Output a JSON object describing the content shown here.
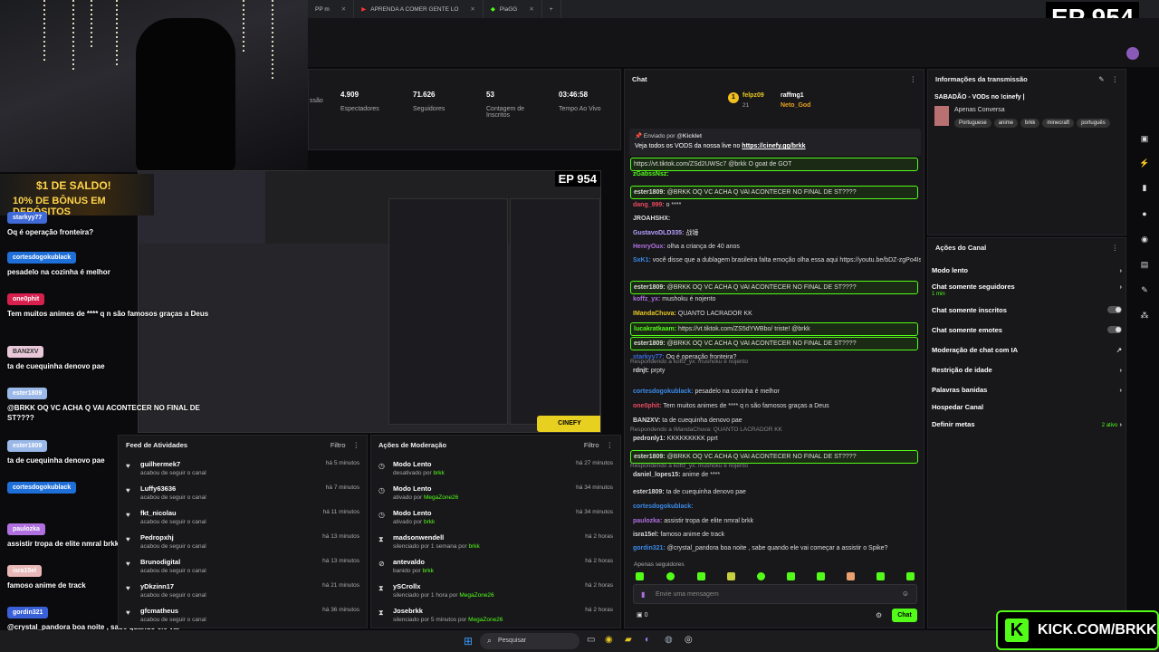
{
  "browser": {
    "tabs": [
      {
        "label": "PP m"
      },
      {
        "label": "APRENDA A COMER GENTE LO"
      },
      {
        "label": "PiaGG"
      }
    ],
    "new_tab": "+"
  },
  "episode": "EP 954",
  "promo": {
    "line1": "$1 DE SALDO!",
    "line2": "10% DE BÔNUS EM DEPÓSITOS"
  },
  "overlay_chat": [
    {
      "user": "starkyy77",
      "text": "Oq é operação fronteira?",
      "color": "#3f6ad8"
    },
    {
      "user": "cortesdogokublack",
      "text": "pesadelo na cozinha é melhor",
      "color": "#1f6fd8"
    },
    {
      "user": "one0phit",
      "text": "Tem muitos animes de **** q n são famosos graças a Deus",
      "color": "#d8204f"
    },
    {
      "user": "BAN2XV",
      "text": "ta de cuequinha denovo pae",
      "color": "#e8c8d8"
    },
    {
      "user": "ester1809",
      "text": "@BRKK OQ VC ACHA Q VAI ACONTECER NO FINAL DE ST????",
      "color": "#9ab8e8"
    },
    {
      "user": "ester1809",
      "text": "ta de cuequinha denovo pae",
      "color": "#9ab8e8"
    },
    {
      "user": "cortesdogokublack",
      "text": "",
      "color": "#1f6fd8"
    },
    {
      "user": "paulozka",
      "text": "assistir tropa de elite nmral brkk",
      "color": "#b070e0"
    },
    {
      "user": "isra15el",
      "text": "famoso anime de track",
      "color": "#e8b8b8"
    },
    {
      "user": "gordin321",
      "text": "@crystal_pandora boa noite , sabe quando ele vai começar a assistir o Spike?",
      "color": "#3a60d8"
    }
  ],
  "stats": [
    {
      "value": "",
      "label": "ssão"
    },
    {
      "value": "4.909",
      "label": "Espectadores"
    },
    {
      "value": "71.626",
      "label": "Seguidores"
    },
    {
      "value": "53",
      "label": "Contagem de Inscritos"
    },
    {
      "value": "03:46:58",
      "label": "Tempo Ao Vivo"
    }
  ],
  "feed": {
    "title": "Feed de Atividades",
    "filter": "Filtro",
    "items": [
      {
        "name": "guilhermek7",
        "desc": "acabou de seguir o canal",
        "time": "há 5 minutos"
      },
      {
        "name": "Luffy63636",
        "desc": "acabou de seguir o canal",
        "time": "há 7 minutos"
      },
      {
        "name": "fkt_nicolau",
        "desc": "acabou de seguir o canal",
        "time": "há 11 minutos"
      },
      {
        "name": "Pedropxhj",
        "desc": "acabou de seguir o canal",
        "time": "há 13 minutos"
      },
      {
        "name": "Brunodigital",
        "desc": "acabou de seguir o canal",
        "time": "há 13 minutos"
      },
      {
        "name": "yDkzinn17",
        "desc": "acabou de seguir o canal",
        "time": "há 21 minutos"
      },
      {
        "name": "gfcmatheus",
        "desc": "acabou de seguir o canal",
        "time": "há 36 minutos"
      }
    ]
  },
  "moderation": {
    "title": "Ações de Moderação",
    "filter": "Filtro",
    "items": [
      {
        "name": "Modo Lento",
        "desc": "desativado por",
        "by": "brkk",
        "time": "há 27 minutos"
      },
      {
        "name": "Modo Lento",
        "desc": "ativado por",
        "by": "MegaZone26",
        "time": "há 34 minutos"
      },
      {
        "name": "Modo Lento",
        "desc": "ativado por",
        "by": "brkk",
        "time": "há 34 minutos"
      },
      {
        "name": "madsonwendell",
        "desc": "silenciado por 1 semana por",
        "by": "brkk",
        "time": "há 2 horas"
      },
      {
        "name": "antevaldo",
        "desc": "banido por",
        "by": "brkk",
        "time": "há 2 horas"
      },
      {
        "name": "ySCrollx",
        "desc": "silenciado por 1 hora por",
        "by": "MegaZone26",
        "time": "há 2 horas"
      },
      {
        "name": "Josebrkk",
        "desc": "silenciado por 5 minutos por",
        "by": "MegaZone26",
        "time": "há 2 horas"
      }
    ]
  },
  "chat": {
    "title": "Chat",
    "top": {
      "first": "felpz09",
      "first_count": "21",
      "second": "raffmg1",
      "third": "Neto_God"
    },
    "pinned": {
      "by_label": "Enviado por",
      "by": "@Kicklet",
      "text": "Veja todos os VODS da nossa live no ",
      "link": "https://cinefy.gg/brkk"
    },
    "messages": [
      {
        "user": "",
        "text": "https://vt.tiktok.com/ZSd2UWSc7 @brkk O goat de GOT",
        "color": "#e84a5f",
        "hl": true
      },
      {
        "user": "zGabssNsz:",
        "text": "",
        "color": "#53fc18",
        "hl": false
      },
      {
        "user": "ester1809:",
        "text": "@BRKK OQ VC ACHA Q VAI ACONTECER NO FINAL DE ST????",
        "color": "#ddd",
        "hl": true
      },
      {
        "user": "dang_999:",
        "text": "o ****",
        "color": "#e84a5f",
        "hl": false
      },
      {
        "user": "JROAHSHX:",
        "text": "",
        "color": "#ddd",
        "hl": false
      },
      {
        "user": "GustavoDLD335:",
        "text": "战锤",
        "color": "#b8a0ff",
        "hl": false
      },
      {
        "user": "HenryOux:",
        "text": "olha a criança de 40 anos",
        "color": "#b070e0",
        "hl": false
      },
      {
        "user": "SxK1:",
        "text": "você disse que a dublagem brasileira falta emoção olha essa aqui https://youtu.be/bDZ-zgPo4Is?si=aAgS3mmWICvu_NW",
        "color": "#3a8ae8",
        "hl": false
      },
      {
        "user": "ester1809:",
        "text": "@BRKK OQ VC ACHA Q VAI ACONTECER NO FINAL DE ST????",
        "color": "#ddd",
        "hl": true
      },
      {
        "user": "koffz_yx:",
        "text": "mushoku é nojento",
        "color": "#b070e0",
        "hl": false
      },
      {
        "user": "IMandaChuva:",
        "text": "QUANTO LACRADOR KK",
        "color": "#e8c820",
        "hl": false
      },
      {
        "user": "lucakratkaam:",
        "text": "https://vt.tiktok.com/ZS5dYWBbo/ triste! @brkk",
        "color": "#53fc18",
        "hl": true
      },
      {
        "user": "ester1809:",
        "text": "@BRKK OQ VC ACHA Q VAI ACONTECER NO FINAL DE ST????",
        "color": "#ddd",
        "hl": true
      },
      {
        "user": "starkyy77:",
        "text": "Oq é operação fronteira?",
        "color": "#3a6ad8",
        "hl": false
      },
      {
        "user": "rdnjt:",
        "text": "prpty",
        "color": "#ddd",
        "hl": false,
        "reply": "Respondendo a koffz_yx: mushoku é nojento"
      },
      {
        "user": "cortesdogokublack:",
        "text": "pesadelo na cozinha é melhor",
        "color": "#3a8ae8",
        "hl": false
      },
      {
        "user": "one0phit:",
        "text": "Tem muitos animes de **** q n são famosos graças a Deus",
        "color": "#e84a5f",
        "hl": false
      },
      {
        "user": "BAN2XV:",
        "text": "ta de cuequinha denovo pae",
        "color": "#ddd",
        "hl": false
      },
      {
        "user": "pedronly1:",
        "text": "KKKKKKKKK pprt",
        "color": "#ddd",
        "hl": false,
        "reply": "Respondendo a IMandaChuva: QUANTO LACRADOR KK"
      },
      {
        "user": "ester1809:",
        "text": "@BRKK OQ VC ACHA Q VAI ACONTECER NO FINAL DE ST????",
        "color": "#ddd",
        "hl": true
      },
      {
        "user": "daniel_lopes15:",
        "text": "anime de ****",
        "color": "#ddd",
        "hl": false,
        "reply": "Respondendo a koffz_yx: mushoku é nojento"
      },
      {
        "user": "ester1809:",
        "text": "ta de cuequinha denovo pae",
        "color": "#ddd",
        "hl": false
      },
      {
        "user": "cortesdogokublack:",
        "text": "",
        "color": "#3a8ae8",
        "hl": false
      },
      {
        "user": "paulozka:",
        "text": "assistir tropa de elite nmral brkk",
        "color": "#b070e0",
        "hl": false
      },
      {
        "user": "isra15el:",
        "text": "famoso anime de track",
        "color": "#ddd",
        "hl": false
      },
      {
        "user": "gordin321:",
        "text": "@crystal_pandora boa noite , sabe quando ele vai começar a assistir o Spike?",
        "color": "#3a8ae8",
        "hl": false
      }
    ],
    "followers_only": "Apenas seguidores",
    "input_placeholder": "Envie uma mensagem",
    "count": "0",
    "send": "Chat"
  },
  "info": {
    "title": "Informações da transmissão",
    "stream_title": "SABADÃO - VODs no !cinefy |",
    "category": "Apenas Conversa",
    "tags": [
      "Portuguese",
      "anime",
      "brkk",
      "minecraft",
      "português"
    ]
  },
  "channel_actions": {
    "title": "Ações do Canal",
    "items": [
      {
        "label": "Modo lento",
        "sub": "",
        "control": "chevron"
      },
      {
        "label": "Chat somente seguidores",
        "sub": "1 min",
        "control": "chevron"
      },
      {
        "label": "Chat somente inscritos",
        "sub": "",
        "control": "toggle"
      },
      {
        "label": "Chat somente emotes",
        "sub": "",
        "control": "toggle"
      },
      {
        "label": "Moderação de chat com IA",
        "sub": "",
        "control": "external"
      },
      {
        "label": "Restrição de idade",
        "sub": "",
        "control": "chevron"
      },
      {
        "label": "Palavras banidas",
        "sub": "",
        "control": "chevron"
      },
      {
        "label": "Hospedar Canal",
        "sub": "",
        "control": "none"
      },
      {
        "label": "Definir metas",
        "sub": "",
        "control": "chevron",
        "status": "2 ativo"
      }
    ]
  },
  "taskbar": {
    "search": "Pesquisar"
  },
  "kick_banner": "KICK.COM/BRKK",
  "colors": {
    "accent": "#53fc18",
    "panel": "#18181b"
  }
}
